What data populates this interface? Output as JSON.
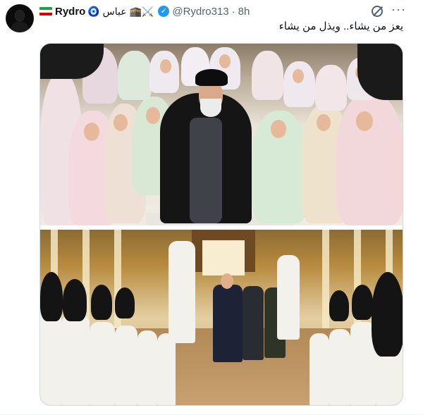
{
  "tweet": {
    "author": {
      "flag_icon": "iran-flag-icon",
      "name": "Rydro",
      "name_emojis": "🧿 عباس 🕋⚔️",
      "handle": "@Rydro313",
      "separator": "·",
      "time": "8h"
    },
    "text": "يعز من يشاء.. ويذل من يشاء",
    "actions": {
      "grok_icon": "grok-icon",
      "more_icon": "more-icon",
      "more_glyph": "···"
    },
    "colors": {
      "verified": "#1d9bf0",
      "secondary_text": "#536471",
      "primary_text": "#0f1419"
    }
  }
}
